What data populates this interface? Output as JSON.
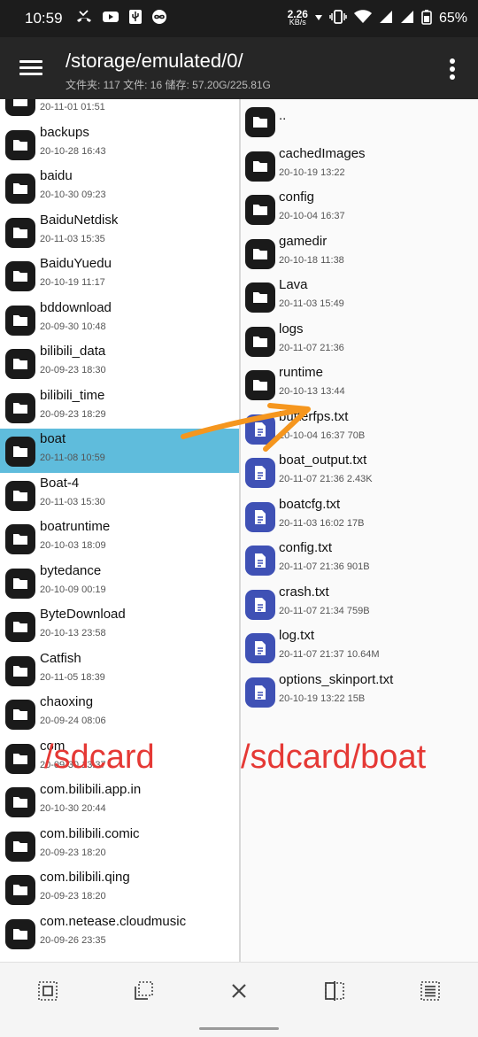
{
  "status": {
    "time": "10:59",
    "speed_value": "2.26",
    "speed_unit": "KB/s",
    "battery": "65%"
  },
  "toolbar": {
    "path": "/storage/emulated/0/",
    "info": "文件夹: 117  文件: 16  储存: 57.20G/225.81G"
  },
  "left_pane": {
    "items": [
      {
        "name": "",
        "meta": "20-11-01 01:51"
      },
      {
        "name": "backups",
        "meta": "20-10-28 16:43"
      },
      {
        "name": "baidu",
        "meta": "20-10-30 09:23"
      },
      {
        "name": "BaiduNetdisk",
        "meta": "20-11-03 15:35"
      },
      {
        "name": "BaiduYuedu",
        "meta": "20-10-19 11:17"
      },
      {
        "name": "bddownload",
        "meta": "20-09-30 10:48"
      },
      {
        "name": "bilibili_data",
        "meta": "20-09-23 18:30"
      },
      {
        "name": "bilibili_time",
        "meta": "20-09-23 18:29"
      },
      {
        "name": "boat",
        "meta": "20-11-08 10:59"
      },
      {
        "name": "Boat-4",
        "meta": "20-11-03 15:30"
      },
      {
        "name": "boatruntime",
        "meta": "20-10-03 18:09"
      },
      {
        "name": "bytedance",
        "meta": "20-10-09 00:19"
      },
      {
        "name": "ByteDownload",
        "meta": "20-10-13 23:58"
      },
      {
        "name": "Catfish",
        "meta": "20-11-05 18:39"
      },
      {
        "name": "chaoxing",
        "meta": "20-09-24 08:06"
      },
      {
        "name": "com",
        "meta": "20-09-30 13:37"
      },
      {
        "name": "com.bilibili.app.in",
        "meta": "20-10-30 20:44"
      },
      {
        "name": "com.bilibili.comic",
        "meta": "20-09-23 18:20"
      },
      {
        "name": "com.bilibili.qing",
        "meta": "20-09-23 18:20"
      },
      {
        "name": "com.netease.cloudmusic",
        "meta": "20-09-26 23:35"
      }
    ]
  },
  "right_pane": {
    "items": [
      {
        "name": "..",
        "meta": ""
      },
      {
        "name": "cachedImages",
        "meta": "20-10-19 13:22"
      },
      {
        "name": "config",
        "meta": "20-10-04 16:37"
      },
      {
        "name": "gamedir",
        "meta": "20-10-18 11:38"
      },
      {
        "name": "Lava",
        "meta": "20-11-03 15:49"
      },
      {
        "name": "logs",
        "meta": "20-11-07 21:36"
      },
      {
        "name": "runtime",
        "meta": "20-10-13 13:44"
      },
      {
        "name": "butterfps.txt",
        "meta": "20-10-04 16:37  70B"
      },
      {
        "name": "boat_output.txt",
        "meta": "20-11-07 21:36  2.43K"
      },
      {
        "name": "boatcfg.txt",
        "meta": "20-11-03 16:02  17B"
      },
      {
        "name": "config.txt",
        "meta": "20-11-07 21:36  901B"
      },
      {
        "name": "crash.txt",
        "meta": "20-11-07 21:34  759B"
      },
      {
        "name": "log.txt",
        "meta": "20-11-07 21:37  10.64M"
      },
      {
        "name": "options_skinport.txt",
        "meta": "20-10-19 13:22  15B"
      }
    ]
  },
  "annotations": {
    "left": "/sdcard",
    "right": "/sdcard/boat"
  },
  "colors": {
    "selected": "#5fbcdc",
    "folder_icon": "#1a1a1a",
    "file_icon": "#3f51b5",
    "annotation_text": "#e53935",
    "arrow": "#f5961e"
  }
}
